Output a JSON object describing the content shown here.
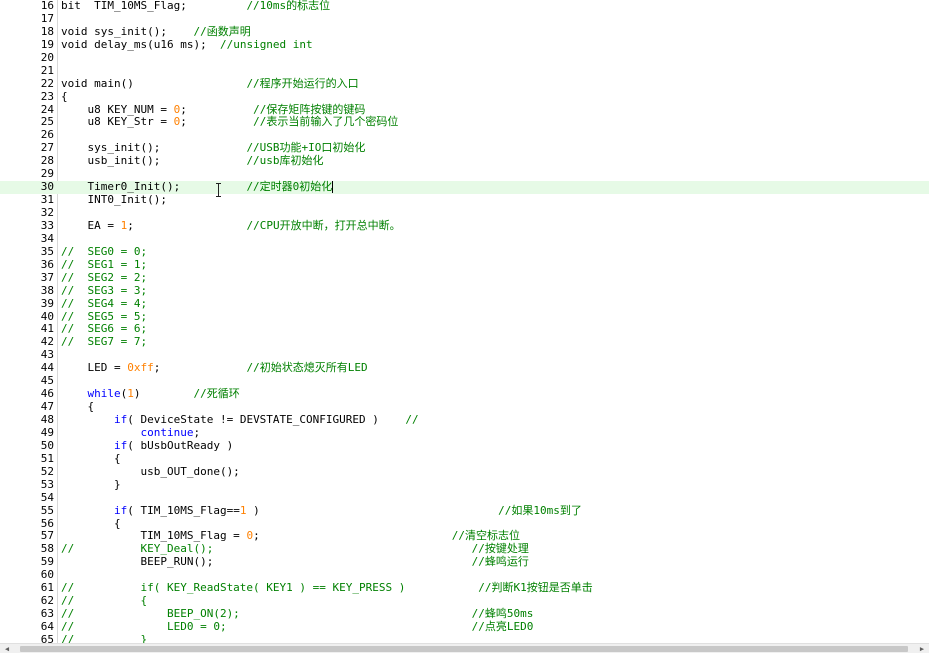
{
  "editor": {
    "current_line": "30",
    "lines": [
      {
        "n": "16",
        "segs": [
          {
            "t": "bit  TIM_10MS_Flag;         ",
            "c": ""
          },
          {
            "t": "//10ms的标志位",
            "c": "cm"
          }
        ]
      },
      {
        "n": "17",
        "segs": []
      },
      {
        "n": "18",
        "segs": [
          {
            "t": "void sys_init();    ",
            "c": ""
          },
          {
            "t": "//函数声明",
            "c": "cm"
          }
        ]
      },
      {
        "n": "19",
        "segs": [
          {
            "t": "void delay_ms(u16 ms);  ",
            "c": ""
          },
          {
            "t": "//unsigned int",
            "c": "cm"
          }
        ]
      },
      {
        "n": "20",
        "segs": []
      },
      {
        "n": "21",
        "segs": []
      },
      {
        "n": "22",
        "segs": [
          {
            "t": "void main()                 ",
            "c": ""
          },
          {
            "t": "//程序开始运行的入口",
            "c": "cm"
          }
        ]
      },
      {
        "n": "23",
        "segs": [
          {
            "t": "{",
            "c": ""
          }
        ]
      },
      {
        "n": "24",
        "segs": [
          {
            "t": "    u8 KEY_NUM = ",
            "c": ""
          },
          {
            "t": "0",
            "c": "num"
          },
          {
            "t": ";          ",
            "c": ""
          },
          {
            "t": "//保存矩阵按键的键码",
            "c": "cm"
          }
        ]
      },
      {
        "n": "25",
        "segs": [
          {
            "t": "    u8 KEY_Str = ",
            "c": ""
          },
          {
            "t": "0",
            "c": "num"
          },
          {
            "t": ";          ",
            "c": ""
          },
          {
            "t": "//表示当前输入了几个密码位",
            "c": "cm"
          }
        ]
      },
      {
        "n": "26",
        "segs": []
      },
      {
        "n": "27",
        "segs": [
          {
            "t": "    sys_init();             ",
            "c": ""
          },
          {
            "t": "//USB功能+IO口初始化",
            "c": "cm"
          }
        ]
      },
      {
        "n": "28",
        "segs": [
          {
            "t": "    usb_init();             ",
            "c": ""
          },
          {
            "t": "//usb库初始化",
            "c": "cm"
          }
        ]
      },
      {
        "n": "29",
        "segs": []
      },
      {
        "n": "30",
        "segs": [
          {
            "t": "    Timer0_Init();          ",
            "c": ""
          },
          {
            "t": "//定时器0初始化",
            "c": "cm"
          }
        ]
      },
      {
        "n": "31",
        "segs": [
          {
            "t": "    INT0_Init();",
            "c": ""
          }
        ]
      },
      {
        "n": "32",
        "segs": []
      },
      {
        "n": "33",
        "segs": [
          {
            "t": "    EA = ",
            "c": ""
          },
          {
            "t": "1",
            "c": "num"
          },
          {
            "t": ";                 ",
            "c": ""
          },
          {
            "t": "//CPU开放中断，打开总中断。",
            "c": "cm"
          }
        ]
      },
      {
        "n": "34",
        "segs": []
      },
      {
        "n": "35",
        "segs": [
          {
            "t": "//  SEG0 = 0;",
            "c": "cm"
          }
        ]
      },
      {
        "n": "36",
        "segs": [
          {
            "t": "//  SEG1 = 1;",
            "c": "cm"
          }
        ]
      },
      {
        "n": "37",
        "segs": [
          {
            "t": "//  SEG2 = 2;",
            "c": "cm"
          }
        ]
      },
      {
        "n": "38",
        "segs": [
          {
            "t": "//  SEG3 = 3;",
            "c": "cm"
          }
        ]
      },
      {
        "n": "39",
        "segs": [
          {
            "t": "//  SEG4 = 4;",
            "c": "cm"
          }
        ]
      },
      {
        "n": "40",
        "segs": [
          {
            "t": "//  SEG5 = 5;",
            "c": "cm"
          }
        ]
      },
      {
        "n": "41",
        "segs": [
          {
            "t": "//  SEG6 = 6;",
            "c": "cm"
          }
        ]
      },
      {
        "n": "42",
        "segs": [
          {
            "t": "//  SEG7 = 7;",
            "c": "cm"
          }
        ]
      },
      {
        "n": "43",
        "segs": []
      },
      {
        "n": "44",
        "segs": [
          {
            "t": "    LED = ",
            "c": ""
          },
          {
            "t": "0xff",
            "c": "num"
          },
          {
            "t": ";             ",
            "c": ""
          },
          {
            "t": "//初始状态熄灭所有LED",
            "c": "cm"
          }
        ]
      },
      {
        "n": "45",
        "segs": []
      },
      {
        "n": "46",
        "segs": [
          {
            "t": "    ",
            "c": ""
          },
          {
            "t": "while",
            "c": "kw"
          },
          {
            "t": "(",
            "c": ""
          },
          {
            "t": "1",
            "c": "num"
          },
          {
            "t": ")        ",
            "c": ""
          },
          {
            "t": "//死循环",
            "c": "cm"
          }
        ]
      },
      {
        "n": "47",
        "segs": [
          {
            "t": "    {",
            "c": ""
          }
        ]
      },
      {
        "n": "48",
        "segs": [
          {
            "t": "        ",
            "c": ""
          },
          {
            "t": "if",
            "c": "kw"
          },
          {
            "t": "( DeviceState != DEVSTATE_CONFIGURED )    ",
            "c": ""
          },
          {
            "t": "//",
            "c": "cm"
          }
        ]
      },
      {
        "n": "49",
        "segs": [
          {
            "t": "            ",
            "c": ""
          },
          {
            "t": "continue",
            "c": "kw"
          },
          {
            "t": ";",
            "c": ""
          }
        ]
      },
      {
        "n": "50",
        "segs": [
          {
            "t": "        ",
            "c": ""
          },
          {
            "t": "if",
            "c": "kw"
          },
          {
            "t": "( bUsbOutReady )",
            "c": ""
          }
        ]
      },
      {
        "n": "51",
        "segs": [
          {
            "t": "        {",
            "c": ""
          }
        ]
      },
      {
        "n": "52",
        "segs": [
          {
            "t": "            usb_OUT_done();",
            "c": ""
          }
        ]
      },
      {
        "n": "53",
        "segs": [
          {
            "t": "        }",
            "c": ""
          }
        ]
      },
      {
        "n": "54",
        "segs": []
      },
      {
        "n": "55",
        "segs": [
          {
            "t": "        ",
            "c": ""
          },
          {
            "t": "if",
            "c": "kw"
          },
          {
            "t": "( TIM_10MS_Flag==",
            "c": ""
          },
          {
            "t": "1",
            "c": "num"
          },
          {
            "t": " )                                    ",
            "c": ""
          },
          {
            "t": "//如果10ms到了",
            "c": "cm"
          }
        ]
      },
      {
        "n": "56",
        "segs": [
          {
            "t": "        {",
            "c": ""
          }
        ]
      },
      {
        "n": "57",
        "segs": [
          {
            "t": "            TIM_10MS_Flag = ",
            "c": ""
          },
          {
            "t": "0",
            "c": "num"
          },
          {
            "t": ";                             ",
            "c": ""
          },
          {
            "t": "//清空标志位",
            "c": "cm"
          }
        ]
      },
      {
        "n": "58",
        "segs": [
          {
            "t": "//          KEY_Deal();                                       //按键处理",
            "c": "cm"
          }
        ]
      },
      {
        "n": "59",
        "segs": [
          {
            "t": "            BEEP_RUN();                                       ",
            "c": ""
          },
          {
            "t": "//蜂鸣运行",
            "c": "cm"
          }
        ]
      },
      {
        "n": "60",
        "segs": []
      },
      {
        "n": "61",
        "segs": [
          {
            "t": "//          if( KEY_ReadState( KEY1 ) == KEY_PRESS )           //判断K1按钮是否单击",
            "c": "cm"
          }
        ]
      },
      {
        "n": "62",
        "segs": [
          {
            "t": "//          {",
            "c": "cm"
          }
        ]
      },
      {
        "n": "63",
        "segs": [
          {
            "t": "//              BEEP_ON(2);                                   //蜂鸣50ms",
            "c": "cm"
          }
        ]
      },
      {
        "n": "64",
        "segs": [
          {
            "t": "//              LED0 = 0;                                     //点亮LED0",
            "c": "cm"
          }
        ]
      },
      {
        "n": "65",
        "segs": [
          {
            "t": "//          }",
            "c": "cm"
          }
        ]
      }
    ]
  }
}
